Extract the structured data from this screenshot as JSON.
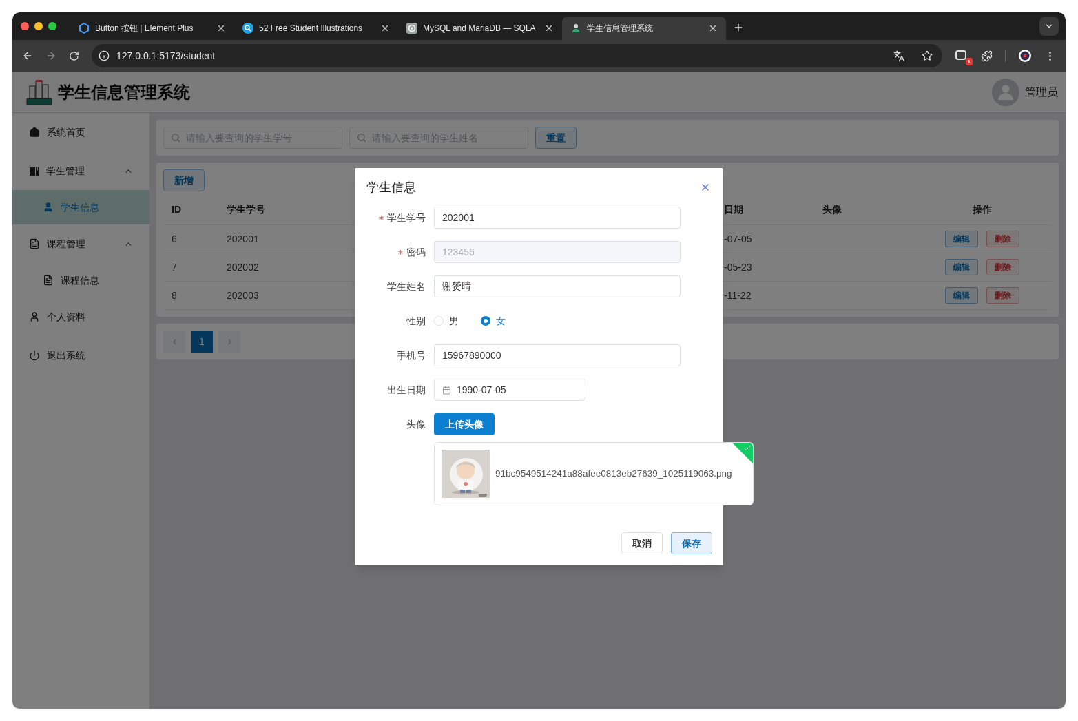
{
  "browser": {
    "tabs": [
      {
        "title": "Button 按钮 | Element Plus",
        "selected": false
      },
      {
        "title": "52 Free Student Illustrations",
        "selected": false
      },
      {
        "title": "MySQL and MariaDB — SQLA",
        "selected": false
      },
      {
        "title": "学生信息管理系统",
        "selected": true
      }
    ],
    "url": "127.0.0.1:5173/student",
    "extension_badge": "1"
  },
  "app": {
    "title": "学生信息管理系统",
    "user": "管理员",
    "sidebar": [
      {
        "label": "系统首页",
        "selected": false
      },
      {
        "label": "学生管理",
        "expanded": true,
        "children": [
          {
            "label": "学生信息",
            "selected": true
          }
        ]
      },
      {
        "label": "课程管理",
        "expanded": true,
        "children": [
          {
            "label": "课程信息",
            "selected": false
          }
        ]
      },
      {
        "label": "个人资料",
        "selected": false
      },
      {
        "label": "退出系统",
        "selected": false
      }
    ],
    "search": {
      "fields": [
        {
          "placeholder": "请输入要查询的学生学号"
        },
        {
          "placeholder": "请输入要查询的学生姓名"
        }
      ],
      "button": "重置"
    },
    "add_button": "新增",
    "table": {
      "columns": [
        "ID",
        "学生学号",
        "",
        "日期",
        "头像",
        "操作"
      ],
      "rows": [
        {
          "cells": [
            "6",
            "202001",
            "",
            "-07-05"
          ],
          "actions": [
            "编辑",
            "删除"
          ]
        },
        {
          "cells": [
            "7",
            "202002",
            "",
            "-05-23"
          ],
          "actions": [
            "编辑",
            "删除"
          ]
        },
        {
          "cells": [
            "8",
            "202003",
            "",
            "-11-22"
          ],
          "actions": [
            "编辑",
            "删除"
          ]
        }
      ]
    },
    "pagination": {
      "pages": [
        {
          "label": "1",
          "selected": true
        }
      ]
    }
  },
  "dialog": {
    "title": "学生信息",
    "fields": [
      {
        "kind": "text",
        "label": "学生学号",
        "required": true,
        "value": "202001",
        "disabled": false
      },
      {
        "kind": "text",
        "label": "密码",
        "required": true,
        "value": "123456",
        "disabled": true
      },
      {
        "kind": "text",
        "label": "学生姓名",
        "required": false,
        "value": "谢赟晴",
        "disabled": false
      },
      {
        "kind": "radio",
        "label": "性别",
        "required": false,
        "options": [
          {
            "label": "男",
            "selected": false
          },
          {
            "label": "女",
            "selected": true
          }
        ]
      },
      {
        "kind": "text",
        "label": "手机号",
        "required": false,
        "value": "15967890000",
        "disabled": false
      },
      {
        "kind": "date",
        "label": "出生日期",
        "required": false,
        "value": "1990-07-05"
      },
      {
        "kind": "upload",
        "label": "头像",
        "required": false,
        "button": "上传头像",
        "file": {
          "name": "91bc9549514241a88afee0813eb27639_1025119063.png",
          "uploaded": true
        }
      }
    ],
    "buttons": [
      "取消",
      "保存"
    ]
  }
}
